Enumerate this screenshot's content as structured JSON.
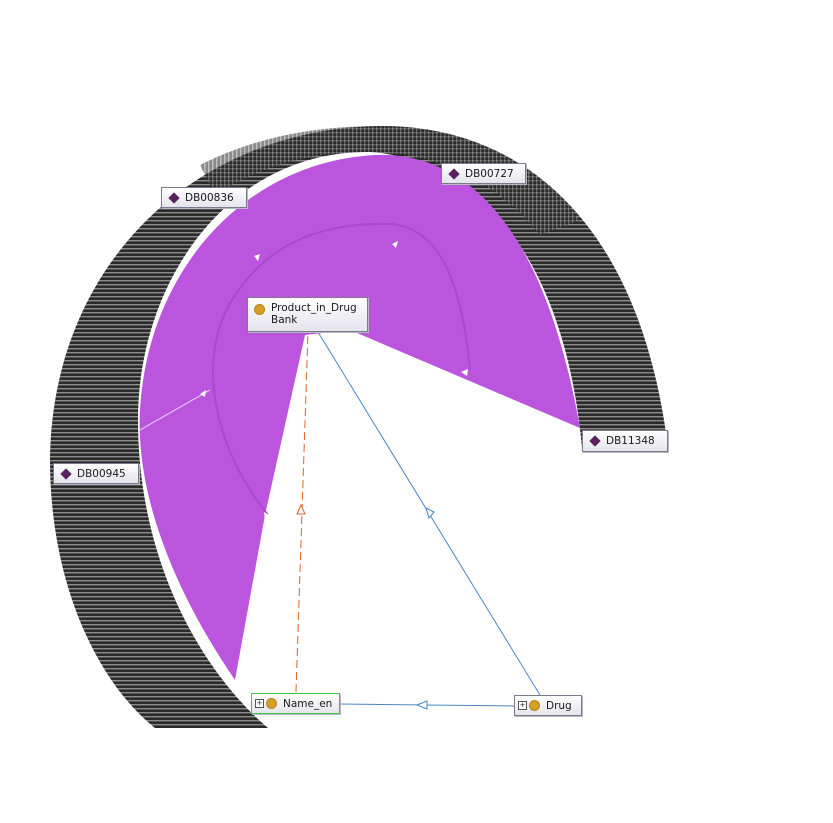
{
  "colors": {
    "band": "#bb55dd",
    "ring_dark": "#2a2a2a",
    "ring_light": "#8c8c8c",
    "subclass_edge": "#4a86c0",
    "equivalent_edge": "#e0622a",
    "class_dot": "#d4a028",
    "individual_diamond": "#5a2060"
  },
  "nodes": {
    "product": {
      "line1": "Product_in_Drug",
      "line2": "Bank",
      "icon": "class-circle-icon"
    },
    "name_en": {
      "label": "Name_en",
      "icon": "class-circle-icon",
      "expand": "+"
    },
    "drug": {
      "label": "Drug",
      "icon": "class-circle-icon",
      "expand": "+"
    },
    "db00836": {
      "label": "DB00836",
      "icon": "individual-diamond-icon"
    },
    "db00727": {
      "label": "DB00727",
      "icon": "individual-diamond-icon"
    },
    "db11348": {
      "label": "DB11348",
      "icon": "individual-diamond-icon"
    },
    "db00945": {
      "label": "DB00945",
      "icon": "individual-diamond-icon"
    }
  }
}
